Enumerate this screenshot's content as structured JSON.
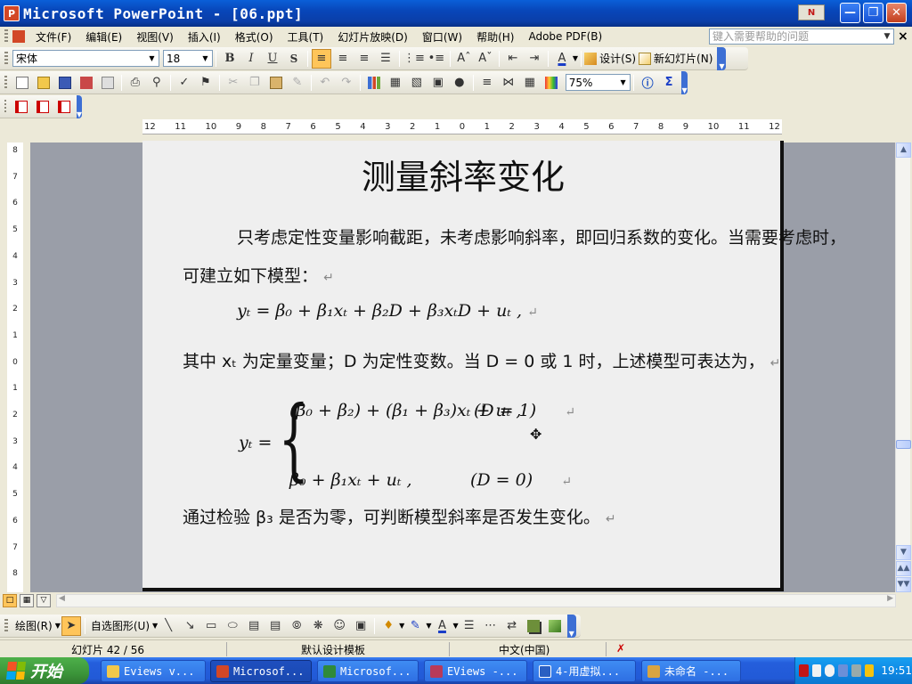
{
  "window": {
    "title": "Microsoft PowerPoint - [06.ppt]",
    "app_icon_letter": "P",
    "badge": "N"
  },
  "menu": {
    "items": [
      "文件(F)",
      "编辑(E)",
      "视图(V)",
      "插入(I)",
      "格式(O)",
      "工具(T)",
      "幻灯片放映(D)",
      "窗口(W)",
      "帮助(H)",
      "Adobe PDF(B)"
    ],
    "help_placeholder": "键入需要帮助的问题"
  },
  "format_toolbar": {
    "font": "宋体",
    "size": "18",
    "bold": "B",
    "italic": "I",
    "underline": "U",
    "shadow": "S",
    "design_label": "设计(S)",
    "new_slide_label": "新幻灯片(N)"
  },
  "standard_toolbar": {
    "zoom": "75%"
  },
  "ruler": {
    "h_ticks": [
      "12",
      "11",
      "10",
      "9",
      "8",
      "7",
      "6",
      "5",
      "4",
      "3",
      "2",
      "1",
      "0",
      "1",
      "2",
      "3",
      "4",
      "5",
      "6",
      "7",
      "8",
      "9",
      "10",
      "11",
      "12"
    ],
    "v_ticks": [
      "8",
      "7",
      "6",
      "5",
      "4",
      "3",
      "2",
      "1",
      "0",
      "1",
      "2",
      "3",
      "4",
      "5",
      "6",
      "7",
      "8"
    ]
  },
  "slide": {
    "title": "测量斜率变化",
    "para1_line1": "只考虑定性变量影响截距，未考虑影响斜率，即回归系数的变化。当需要考虑时，",
    "para1_line2": "可建立如下模型：",
    "equation1": "yₜ = β₀ + β₁xₜ + β₂D + β₃xₜD + uₜ ,",
    "para2": "其中 xₜ 为定量变量；D 为定性变数。当 D = 0 或 1 时，上述模型可表达为，",
    "lhs": "yₜ =",
    "case1": "(β₀ + β₂) + (β₁ + β₃)xₜ + uₜ ,",
    "case1_cond": "(D = 1)",
    "case2": "β₀ + β₁xₜ + uₜ ,",
    "case2_cond": "(D = 0)",
    "para3": "通过检验 β₃ 是否为零，可判断模型斜率是否发生变化。",
    "para_mark": "↵"
  },
  "drawing_toolbar": {
    "draw_label": "绘图(R)",
    "autoshapes_label": "自选图形(U)"
  },
  "status": {
    "slide_pos": "幻灯片 42 / 56",
    "template": "默认设计模板",
    "language": "中文(中国)"
  },
  "taskbar": {
    "start_label": "开始",
    "tasks": [
      "Eviews v...",
      "Microsof...",
      "Microsof...",
      "EViews -...",
      "4-用虚拟...",
      "未命名 -..."
    ],
    "clock": "19:51"
  }
}
